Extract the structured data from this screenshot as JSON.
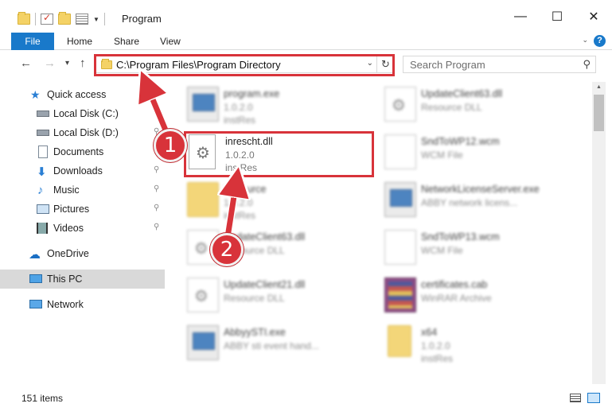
{
  "window": {
    "title": "Program",
    "minimize_glyph": "—",
    "maximize_glyph": "☐",
    "close_glyph": "✕"
  },
  "ribbon": {
    "tabs": [
      "File",
      "Home",
      "Share",
      "View"
    ],
    "help_glyph": "?",
    "collapse_glyph": "⌄"
  },
  "nav": {
    "back_glyph": "←",
    "forward_glyph": "→",
    "recent_glyph": "▾",
    "up_glyph": "↑",
    "address": "C:\\Program Files\\Program Directory",
    "refresh_glyph": "↻",
    "dropdown_glyph": "⌄",
    "search_placeholder": "Search Program",
    "search_glyph": "⚲"
  },
  "sidebar": {
    "items": [
      {
        "label": "Quick access",
        "icon": "star-icon"
      },
      {
        "label": "Local Disk (C:)",
        "icon": "drive-icon"
      },
      {
        "label": "Local Disk (D:)",
        "icon": "drive-icon"
      },
      {
        "label": "Documents",
        "icon": "documents-icon"
      },
      {
        "label": "Downloads",
        "icon": "downloads-icon"
      },
      {
        "label": "Music",
        "icon": "music-icon"
      },
      {
        "label": "Pictures",
        "icon": "pictures-icon"
      },
      {
        "label": "Videos",
        "icon": "videos-icon"
      },
      {
        "label": "OneDrive",
        "icon": "cloud-icon"
      },
      {
        "label": "This PC",
        "icon": "computer-icon"
      },
      {
        "label": "Network",
        "icon": "network-icon"
      }
    ],
    "pin_glyph": "📌"
  },
  "files": [
    {
      "name": "program.exe",
      "line1": "1.0.2.0",
      "line2": "instRes",
      "icon": "exe-icon"
    },
    {
      "name": "UpdateClient63.dll",
      "line1": "Resource DLL",
      "line2": "",
      "icon": "dll-icon"
    },
    {
      "name": "inrescht.dll",
      "line1": "1.0.2.0",
      "line2": "instRes",
      "icon": "dll-icon"
    },
    {
      "name": "SndToWP12.wcm",
      "line1": "WCM File",
      "line2": "",
      "icon": "file-icon"
    },
    {
      "name": "Resource",
      "line1": "1.0.2.0",
      "line2": "instRes",
      "icon": "folder-icon"
    },
    {
      "name": "NetworkLicenseServer.exe",
      "line1": "ABBY network licens...",
      "line2": "",
      "icon": "exe-icon"
    },
    {
      "name": "UpdateClient63.dll",
      "line1": "Resource DLL",
      "line2": "",
      "icon": "dll-icon"
    },
    {
      "name": "SndToWP13.wcm",
      "line1": "WCM File",
      "line2": "",
      "icon": "file-icon"
    },
    {
      "name": "UpdateClient21.dll",
      "line1": "Resource DLL",
      "line2": "",
      "icon": "dll-icon"
    },
    {
      "name": "certificates.cab",
      "line1": "WinRAR Archive",
      "line2": "",
      "icon": "archive-icon"
    },
    {
      "name": "AbbyySTI.exe",
      "line1": "ABBY sti event hand...",
      "line2": "",
      "icon": "exe-icon"
    },
    {
      "name": "x64",
      "line1": "1.0.2.0",
      "line2": "instRes",
      "icon": "folder-icon"
    }
  ],
  "status": {
    "item_count": "151 items"
  },
  "annotations": {
    "badge1": "1",
    "badge2": "2",
    "color": "#d8333a"
  }
}
